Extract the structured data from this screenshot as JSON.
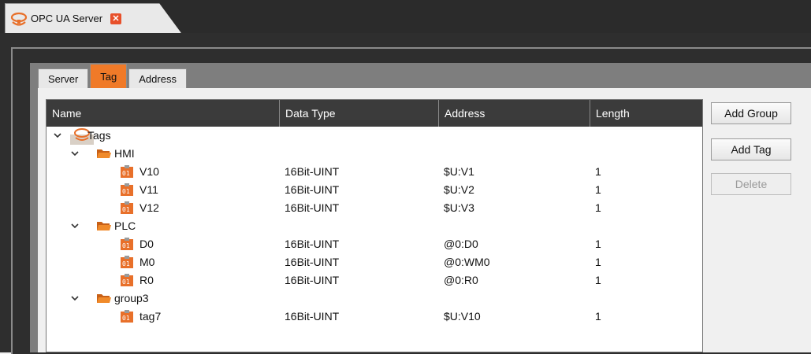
{
  "document_tab": {
    "title": "OPC UA Server",
    "icon": "opc-server-icon",
    "close_icon": "close-icon"
  },
  "tabs": [
    {
      "label": "Server",
      "active": false
    },
    {
      "label": "Tag",
      "active": true
    },
    {
      "label": "Address",
      "active": false
    }
  ],
  "grid": {
    "columns": [
      "Name",
      "Data Type",
      "Address",
      "Length"
    ],
    "root": {
      "label": "Tags",
      "icon": "opc-server-icon"
    },
    "groups": [
      {
        "name": "HMI",
        "tags": [
          {
            "name": "V10",
            "data_type": "16Bit-UINT",
            "address": "$U:V1",
            "length": "1"
          },
          {
            "name": "V11",
            "data_type": "16Bit-UINT",
            "address": "$U:V2",
            "length": "1"
          },
          {
            "name": "V12",
            "data_type": "16Bit-UINT",
            "address": "$U:V3",
            "length": "1"
          }
        ]
      },
      {
        "name": "PLC",
        "tags": [
          {
            "name": "D0",
            "data_type": "16Bit-UINT",
            "address": "@0:D0",
            "length": "1"
          },
          {
            "name": "M0",
            "data_type": "16Bit-UINT",
            "address": "@0:WM0",
            "length": "1"
          },
          {
            "name": "R0",
            "data_type": "16Bit-UINT",
            "address": "@0:R0",
            "length": "1"
          }
        ]
      },
      {
        "name": "group3",
        "tags": [
          {
            "name": "tag7",
            "data_type": "16Bit-UINT",
            "address": "$U:V10",
            "length": "1"
          }
        ]
      }
    ]
  },
  "buttons": {
    "add_group": "Add Group",
    "add_tag": "Add Tag",
    "delete": "Delete"
  },
  "colors": {
    "accent": "#f07a28",
    "header_bg": "#3b3b3b",
    "frame_bg": "#2e2e2e"
  }
}
